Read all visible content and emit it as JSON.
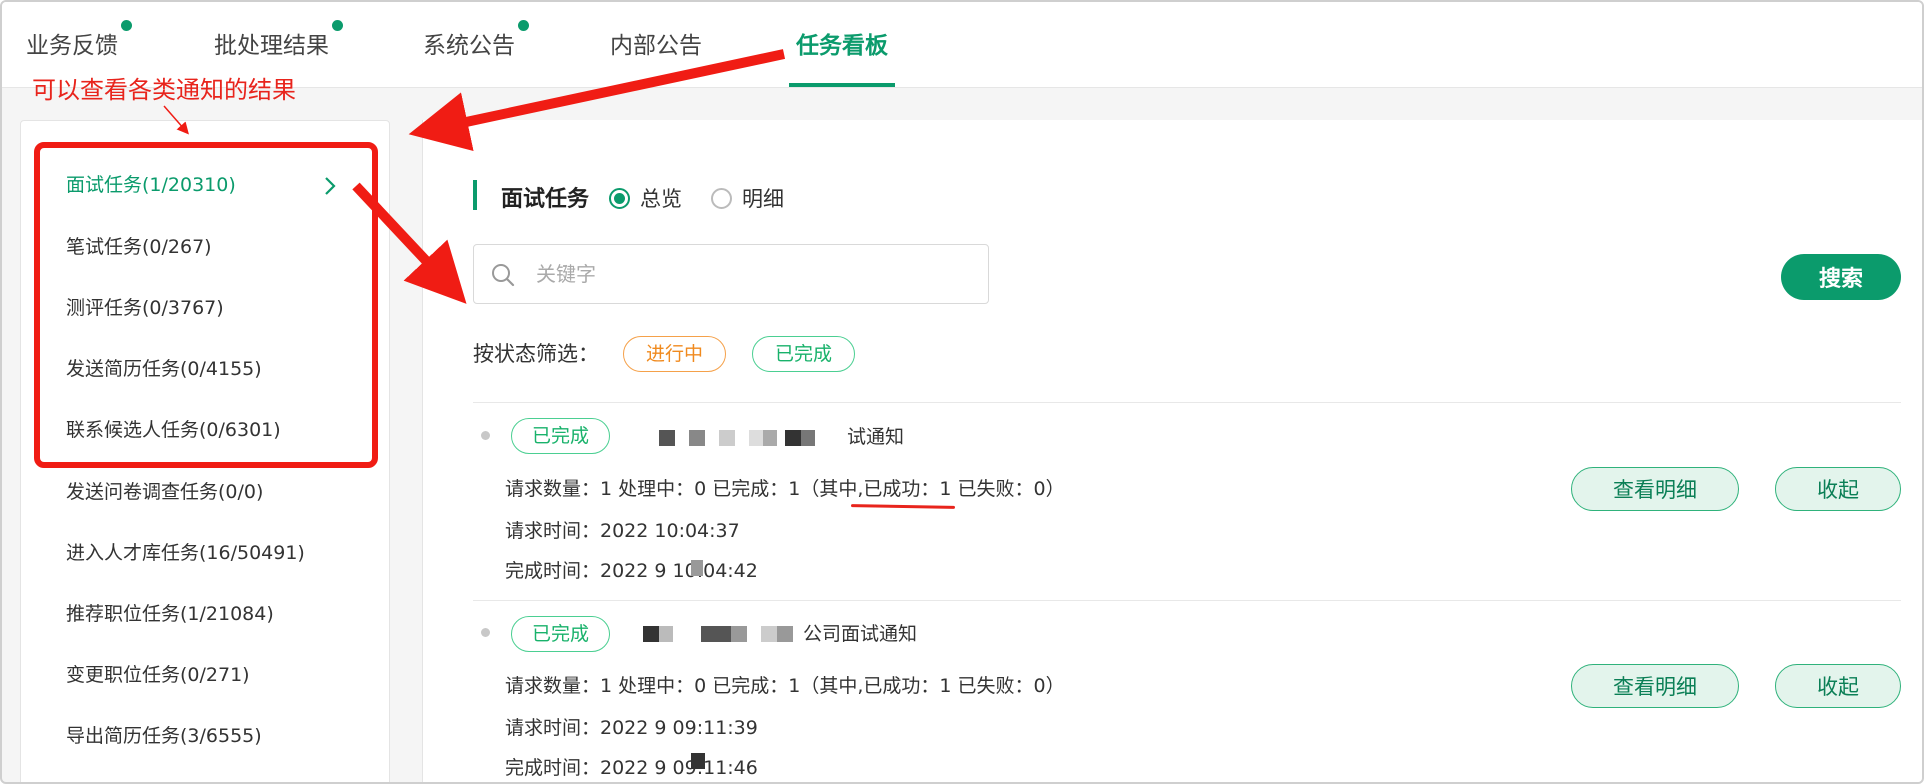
{
  "tabs": [
    {
      "label": "业务反馈",
      "dot": true
    },
    {
      "label": "批处理结果",
      "dot": true
    },
    {
      "label": "系统公告",
      "dot": true
    },
    {
      "label": "内部公告",
      "dot": false
    },
    {
      "label": "任务看板",
      "dot": false,
      "active": true
    }
  ],
  "annotation": {
    "text": "可以查看各类通知的结果",
    "color": "#e8241c"
  },
  "sidebar": {
    "items": [
      {
        "label": "面试任务(1/20310)",
        "active": true
      },
      {
        "label": "笔试任务(0/267)"
      },
      {
        "label": "测评任务(0/3767)"
      },
      {
        "label": "发送简历任务(0/4155)"
      },
      {
        "label": "联系候选人任务(0/6301)"
      },
      {
        "label": "发送问卷调查任务(0/0)"
      },
      {
        "label": "进入人才库任务(16/50491)"
      },
      {
        "label": "推荐职位任务(1/21084)"
      },
      {
        "label": "变更职位任务(0/271)"
      },
      {
        "label": "导出简历任务(3/6555)"
      }
    ],
    "chevron_icon": "chevron-right-icon"
  },
  "main": {
    "section_title": "面试任务",
    "view_options": [
      {
        "label": "总览",
        "checked": true
      },
      {
        "label": "明细",
        "checked": false
      }
    ],
    "search": {
      "placeholder": "关键字",
      "value": "",
      "button_label": "搜索"
    },
    "filter": {
      "label": "按状态筛选：",
      "options": [
        {
          "label": "进行中",
          "color": "#f08a1e"
        },
        {
          "label": "已完成",
          "color": "#19b26b"
        }
      ]
    },
    "tasks": [
      {
        "status": "已完成",
        "name_suffix": "试通知",
        "counts": "请求数量：1 处理中：0 已完成：1（其中,已成功：1 已失败：0）",
        "request_time": "请求时间：2022          10:04:37",
        "finish_time": "完成时间：2022         9 10:04:42",
        "detail_button": "查看明细",
        "collapse_button": "收起"
      },
      {
        "status": "已完成",
        "name_suffix": "公司面试通知",
        "counts": "请求数量：1 处理中：0 已完成：1（其中,已成功：1 已失败：0）",
        "request_time": "请求时间：2022         9 09:11:39",
        "finish_time": "完成时间：2022         9 09:11:46",
        "detail_button": "查看明细",
        "collapse_button": "收起"
      }
    ]
  },
  "colors": {
    "accent": "#0b9b6c",
    "annotation": "#e8241c",
    "orange": "#f08a1e"
  }
}
